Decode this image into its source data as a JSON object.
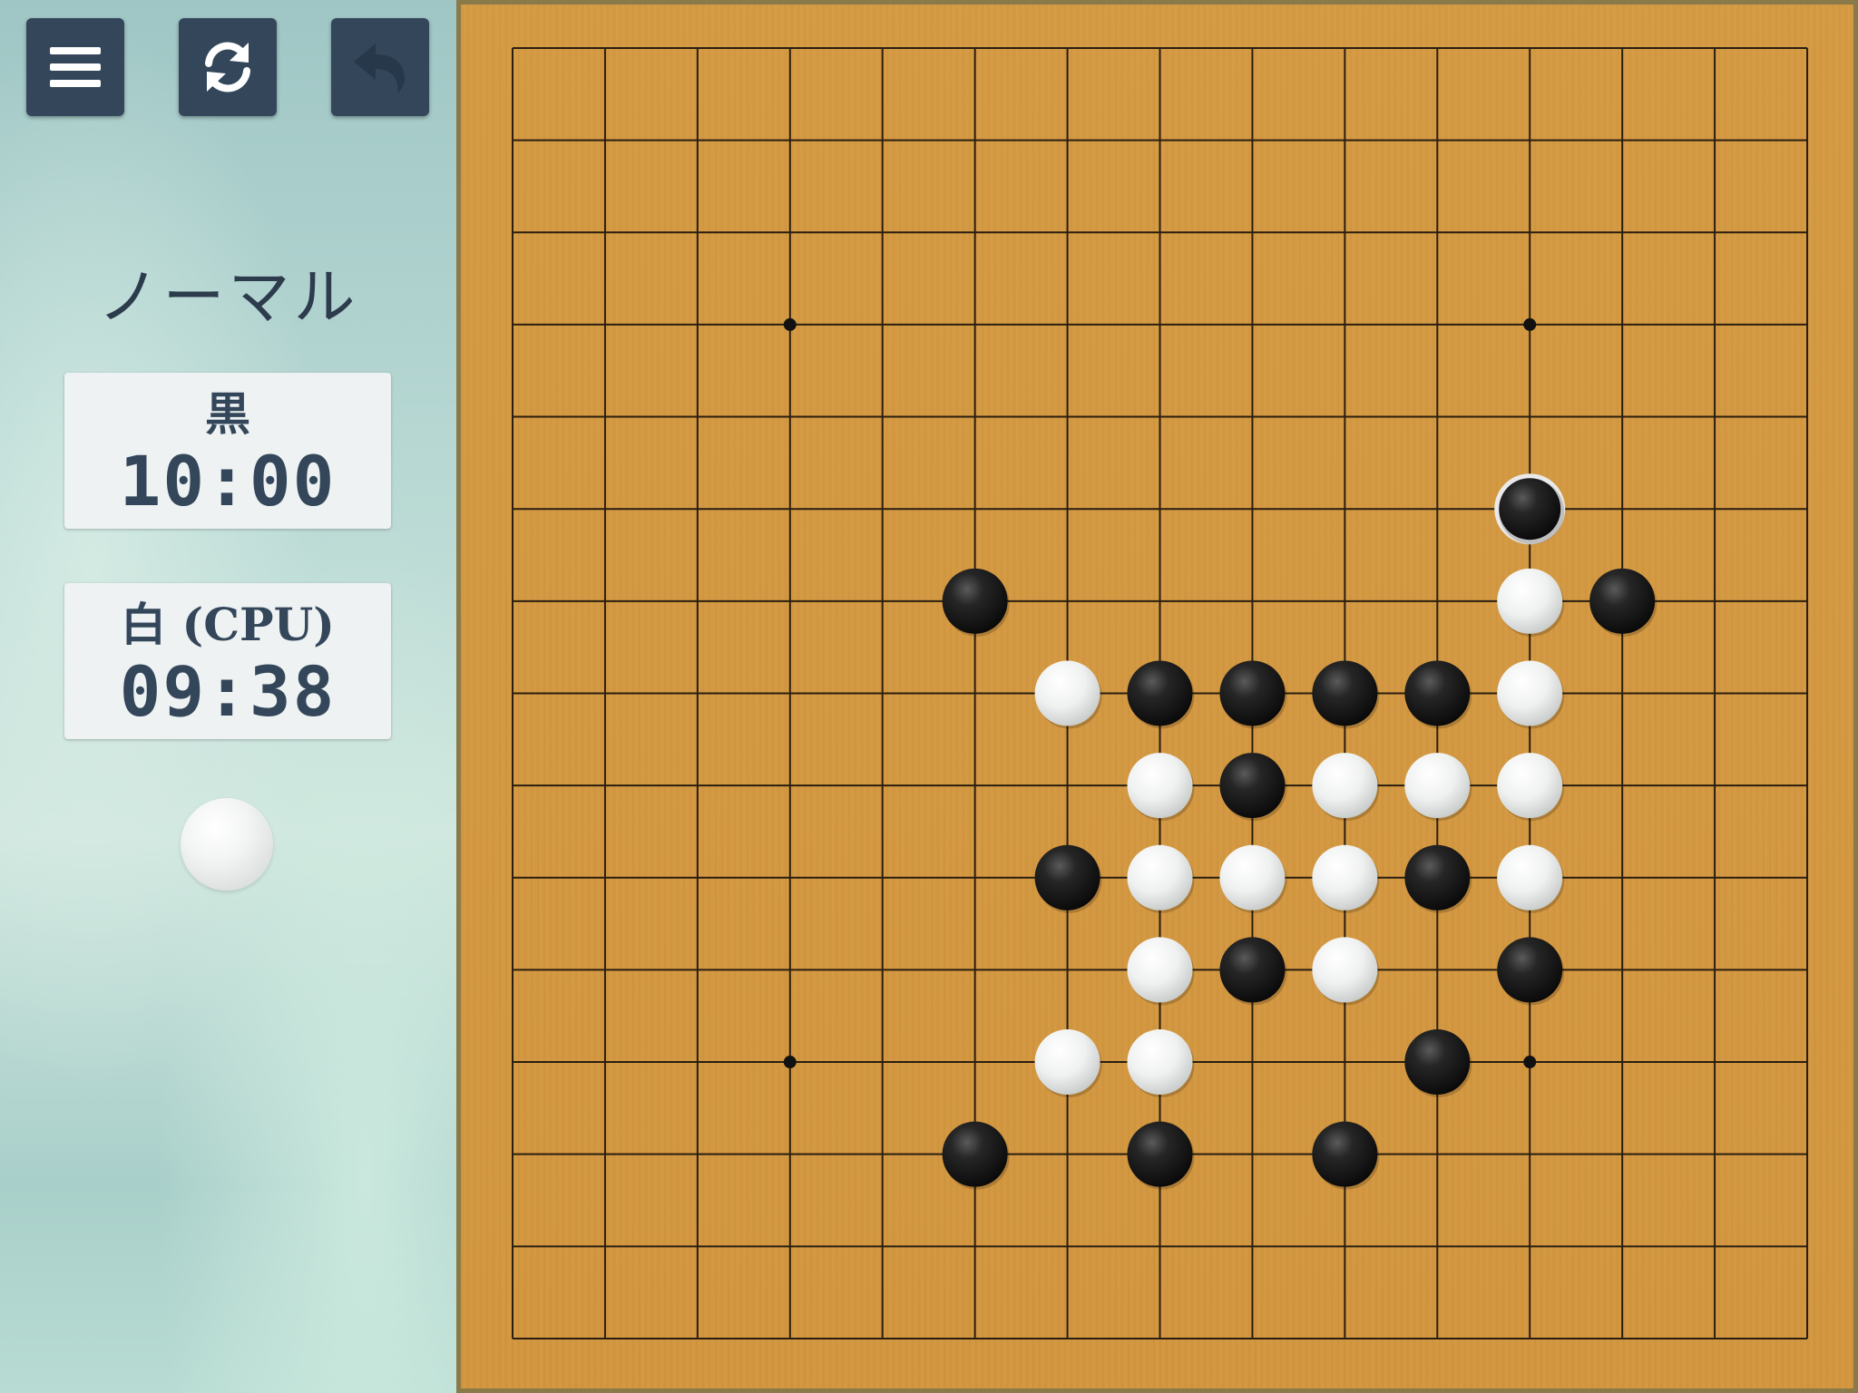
{
  "toolbar": {
    "menu_icon": "hamburger-menu-icon",
    "restart_icon": "refresh-icon",
    "undo_icon": "undo-arrow-icon"
  },
  "mode": {
    "title": "ノーマル"
  },
  "players": {
    "black": {
      "label": "黒",
      "time": "10:00"
    },
    "white": {
      "label": "白 (CPU)",
      "time": "09:38"
    }
  },
  "turn": {
    "current_color": "white"
  },
  "board": {
    "size": 15,
    "star_points": [
      [
        3,
        3
      ],
      [
        11,
        3
      ],
      [
        3,
        11
      ],
      [
        11,
        11
      ]
    ],
    "last_move": [
      11,
      5
    ],
    "stones": [
      {
        "c": 11,
        "r": 5,
        "color": "black"
      },
      {
        "c": 5,
        "r": 6,
        "color": "black"
      },
      {
        "c": 11,
        "r": 6,
        "color": "white"
      },
      {
        "c": 12,
        "r": 6,
        "color": "black"
      },
      {
        "c": 6,
        "r": 7,
        "color": "white"
      },
      {
        "c": 7,
        "r": 7,
        "color": "black"
      },
      {
        "c": 8,
        "r": 7,
        "color": "black"
      },
      {
        "c": 9,
        "r": 7,
        "color": "black"
      },
      {
        "c": 10,
        "r": 7,
        "color": "black"
      },
      {
        "c": 11,
        "r": 7,
        "color": "white"
      },
      {
        "c": 7,
        "r": 8,
        "color": "white"
      },
      {
        "c": 8,
        "r": 8,
        "color": "black"
      },
      {
        "c": 9,
        "r": 8,
        "color": "white"
      },
      {
        "c": 10,
        "r": 8,
        "color": "white"
      },
      {
        "c": 11,
        "r": 8,
        "color": "white"
      },
      {
        "c": 6,
        "r": 9,
        "color": "black"
      },
      {
        "c": 7,
        "r": 9,
        "color": "white"
      },
      {
        "c": 8,
        "r": 9,
        "color": "white"
      },
      {
        "c": 9,
        "r": 9,
        "color": "white"
      },
      {
        "c": 10,
        "r": 9,
        "color": "black"
      },
      {
        "c": 11,
        "r": 9,
        "color": "white"
      },
      {
        "c": 7,
        "r": 10,
        "color": "white"
      },
      {
        "c": 8,
        "r": 10,
        "color": "black"
      },
      {
        "c": 9,
        "r": 10,
        "color": "white"
      },
      {
        "c": 11,
        "r": 10,
        "color": "black"
      },
      {
        "c": 6,
        "r": 11,
        "color": "white"
      },
      {
        "c": 7,
        "r": 11,
        "color": "white"
      },
      {
        "c": 10,
        "r": 11,
        "color": "black"
      },
      {
        "c": 5,
        "r": 12,
        "color": "black"
      },
      {
        "c": 7,
        "r": 12,
        "color": "black"
      },
      {
        "c": 9,
        "r": 12,
        "color": "black"
      }
    ]
  }
}
